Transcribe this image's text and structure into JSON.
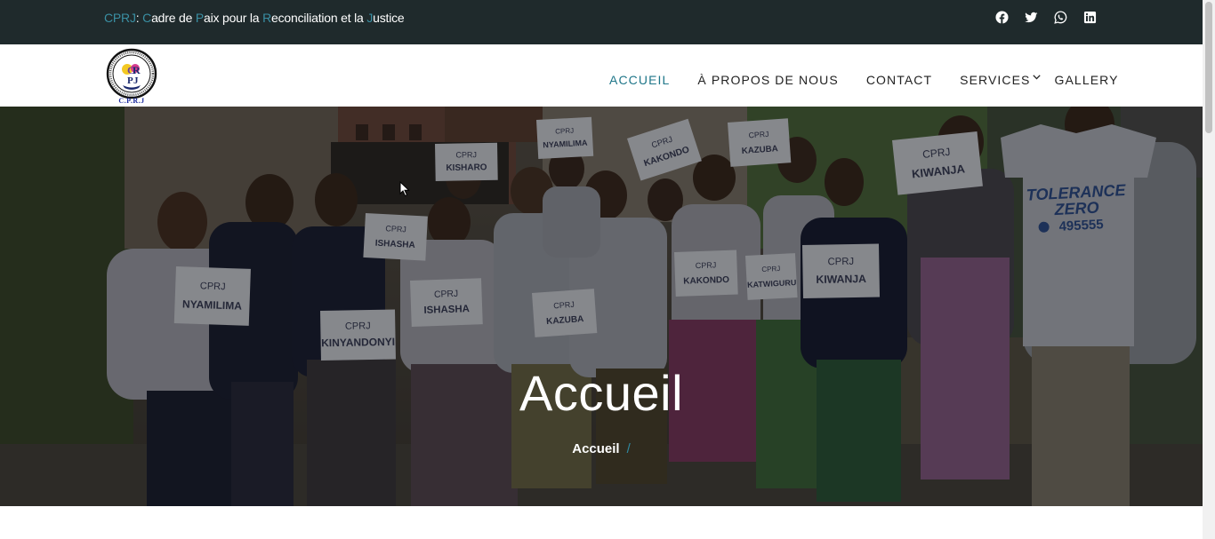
{
  "topbar": {
    "tagline": [
      {
        "text": "CPRJ",
        "initial": true
      },
      {
        "text": ": ",
        "initial": false
      },
      {
        "text": "C",
        "initial": true
      },
      {
        "text": "adre de ",
        "initial": false
      },
      {
        "text": "P",
        "initial": true
      },
      {
        "text": "aix pour la ",
        "initial": false
      },
      {
        "text": "R",
        "initial": true
      },
      {
        "text": "econciliation et la ",
        "initial": false
      },
      {
        "text": "J",
        "initial": true
      },
      {
        "text": "ustice",
        "initial": false
      }
    ],
    "social": [
      "facebook-icon",
      "twitter-icon",
      "whatsapp-icon",
      "linkedin-icon"
    ]
  },
  "logo": {
    "caption": "C.P.R.J"
  },
  "nav": {
    "home": "ACCUEIL",
    "about": "À PROPOS DE NOUS",
    "contact": "CONTACT",
    "services": "SERVICES",
    "gallery": "GALLERY"
  },
  "hero": {
    "title": "Accueil",
    "breadcrumb": "Accueil",
    "breadcrumb_sep": "/",
    "signs": [
      {
        "line1": "CPRJ",
        "line2": "NYAMILIMA"
      },
      {
        "line1": "CPRJ",
        "line2": "KISHARO"
      },
      {
        "line1": "CPRJ",
        "line2": "KAKONDO"
      },
      {
        "line1": "CPRJ",
        "line2": "KAZUBA"
      },
      {
        "line1": "CPRJ",
        "line2": "KIWANJA"
      },
      {
        "line1": "CPRJ",
        "line2": "ISHASHA"
      },
      {
        "line1": "CPRJ",
        "line2": "NYAMILIMA"
      },
      {
        "line1": "CPRJ",
        "line2": "KINYANDONYI"
      },
      {
        "line1": "CPRJ",
        "line2": "ISHASHA"
      },
      {
        "line1": "CPRJ",
        "line2": "KAZUBA"
      },
      {
        "line1": "CPRJ",
        "line2": "KAKONDO"
      },
      {
        "line1": "CPRJ",
        "line2": "KATWIGURU"
      },
      {
        "line1": "CPRJ",
        "line2": "KIWANJA"
      }
    ],
    "shirt": {
      "line1": "TOLERANCE",
      "line2": "ZERO",
      "phone": "495555"
    }
  },
  "colors": {
    "topbar_bg": "#1f2a2c",
    "accent": "#1f7689",
    "initials": "#3a8fa3",
    "nav_text": "#222222"
  }
}
